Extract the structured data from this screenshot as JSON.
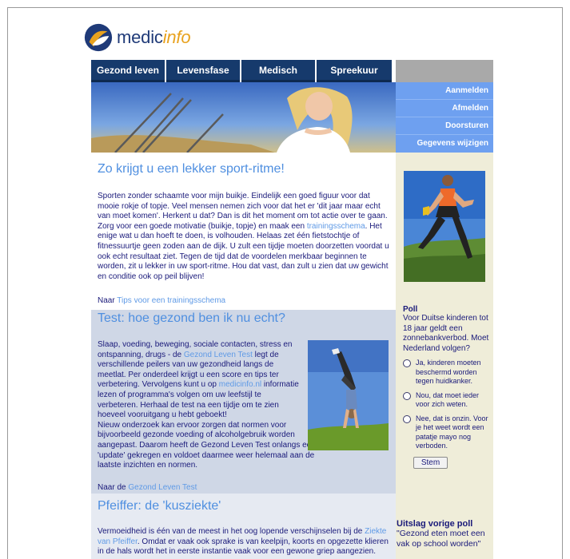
{
  "brand": {
    "name_a": "medic",
    "name_b": "info"
  },
  "nav": {
    "tabs": [
      "Gezond leven",
      "Levensfase",
      "Medisch",
      "Spreekuur"
    ]
  },
  "sidebar_links": [
    "Aanmelden",
    "Afmelden",
    "Doorsturen",
    "Gegevens wijzigen"
  ],
  "article1": {
    "title": "Zo krijgt u een lekker sport-ritme!",
    "body_1": "Sporten zonder schaamte voor mijn buikje. Eindelijk een goed figuur voor dat mooie rokje of topje. Veel mensen nemen zich voor dat het er 'dit jaar maar echt van moet komen'. Herkent u dat? Dan is dit het moment om tot actie over te gaan. Zorg voor een goede motivatie (buikje, topje) en maak een ",
    "link_inline": "trainingsschema",
    "body_2": ". Het enige wat u dan hoeft te doen, is volhouden. Helaas zet één fietstochtje of fitnessuurtje geen zoden aan de dijk. U zult een tijdje moeten doorzetten voordat u ook echt resultaat ziet. Tegen de tijd dat de voordelen merkbaar beginnen te worden, zit u lekker in uw sport-ritme. Hou dat vast, dan zult u zien dat uw gewicht en conditie ook op peil blijven!",
    "more_prefix": "Naar ",
    "more_link": "Tips voor een trainingsschema"
  },
  "article2": {
    "title": "Test: hoe gezond ben ik nu echt?",
    "body_1": "Slaap, voeding, beweging, sociale contacten, stress en ontspanning, drugs - de ",
    "link_1": "Gezond Leven Test",
    "body_2": " legt de verschillende peilers van uw gezondheid langs de meetlat. Per onderdeel krijgt u een score en tips ter verbetering. Vervolgens kunt u op ",
    "link_2": "medicinfo.nl",
    "body_3": " informatie lezen of programma's volgen om uw leefstijl te verbeteren. Herhaal de test na een tijdje om te zien hoeveel vooruitgang u hebt geboekt!",
    "body_4": "Nieuw onderzoek kan ervoor zorgen dat normen voor bijvoorbeeld gezonde voeding of alcoholgebruik worden aangepast. Daarom heeft de Gezond Leven Test onlangs een 'update' gekregen en voldoet daarmee weer helemaal aan de laatste inzichten en normen.",
    "more_prefix": "Naar de ",
    "more_link": "Gezond Leven Test"
  },
  "article3": {
    "title": "Pfeiffer: de 'kusziekte'",
    "body_1": "Vermoeidheid is één van de meest in het oog lopende verschijnselen bij de ",
    "link_1": "Ziekte van Pfeiffer",
    "body_2": ". Omdat er vaak ook sprake is van keelpijn, koorts en opgezette klieren in de hals wordt het in eerste instantie vaak voor een gewone griep aangezien."
  },
  "poll": {
    "heading": "Poll",
    "question": "Voor Duitse kinderen tot 18 jaar geldt een zonnebankverbod. Moet Nederland volgen?",
    "options": [
      "Ja, kinderen moeten beschermd worden tegen huidkanker.",
      "Nou, dat moet ieder voor zich weten.",
      "Nee, dat is onzin. Voor je het weet wordt een patatje mayo nog verboden."
    ],
    "submit": "Stem"
  },
  "previous_poll": {
    "heading": "Uitslag vorige poll",
    "question": "\"Gezond eten moet een vak op school worden\""
  },
  "colors": {
    "nav": "#163a6c",
    "sidebar_links": "#6ea0f0",
    "title": "#4f8fe0",
    "body_text": "#1a1a7a",
    "logo_orange": "#e8a21e"
  }
}
